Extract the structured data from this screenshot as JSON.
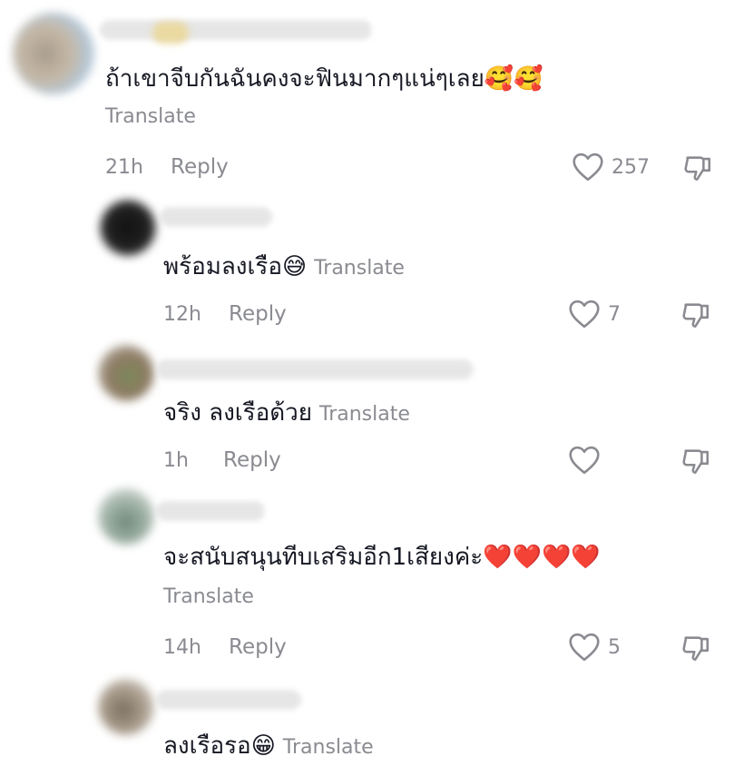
{
  "comments": [
    {
      "text": "ถ้าเขาจีบกันฉันคงจะฟินมากๆแน่ๆเลย",
      "emoji": "🥰🥰",
      "translate": "Translate",
      "time": "21h",
      "reply": "Reply",
      "likes": "257"
    },
    {
      "text": "พร้อมลงเรือ",
      "emoji": "😅",
      "translate": "Translate",
      "time": "12h",
      "reply": "Reply",
      "likes": "7"
    },
    {
      "text": "จริง ลงเรือด้วย",
      "emoji": "",
      "translate": "Translate",
      "time": "1h",
      "reply": "Reply",
      "likes": ""
    },
    {
      "text": "จะสนับสนุนทีบเสริมอีก1เสียงค่ะ",
      "emoji": "❤️❤️❤️❤️",
      "translate": "Translate",
      "time": "14h",
      "reply": "Reply",
      "likes": "5"
    },
    {
      "text": "ลงเรือรอ",
      "emoji": "😁",
      "translate": "Translate",
      "time": "",
      "reply": "",
      "likes": ""
    }
  ],
  "icons": {
    "like": "heart-outline-icon",
    "dislike": "thumbs-down-icon"
  },
  "colors": {
    "text": "#161823",
    "muted": "#8a8b91"
  }
}
